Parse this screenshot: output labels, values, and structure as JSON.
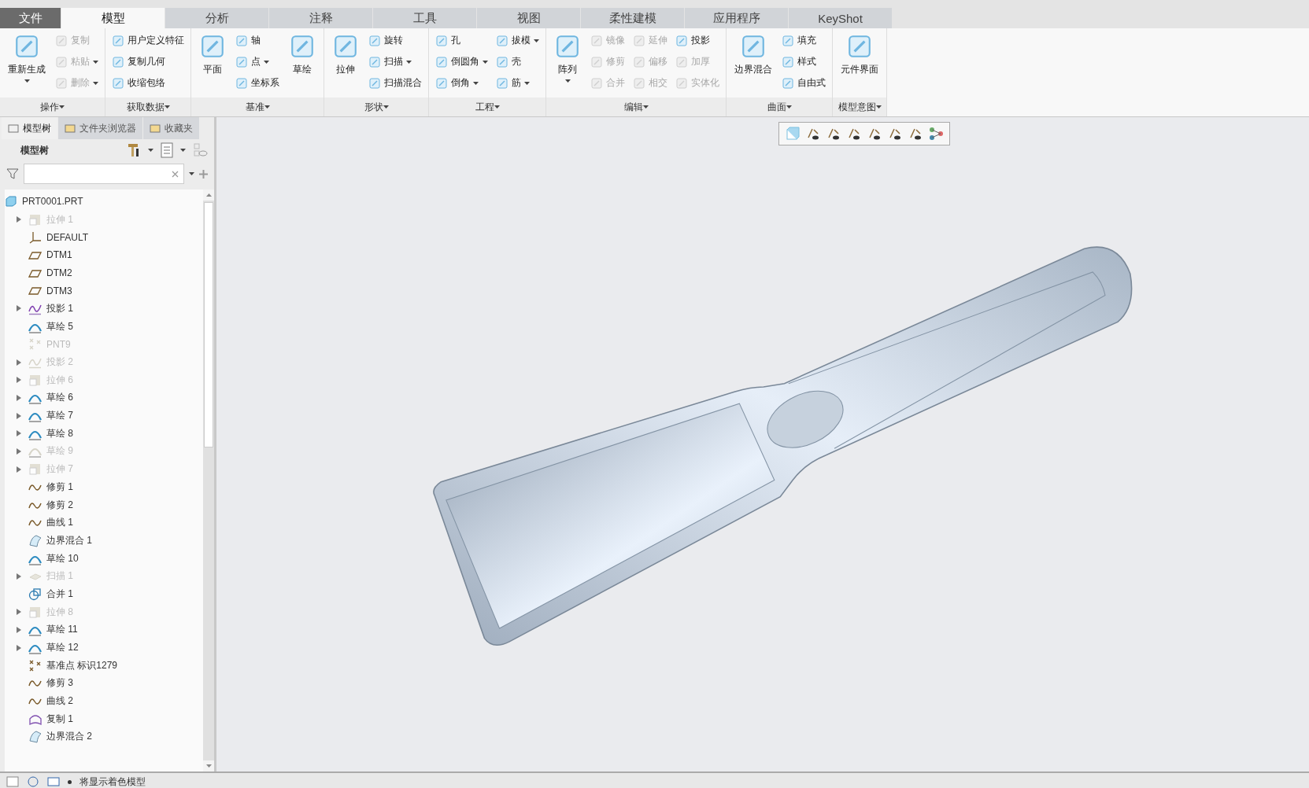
{
  "ribbon_tabs": [
    {
      "label": "文件",
      "kind": "file",
      "selected": false
    },
    {
      "label": "模型",
      "kind": "tab",
      "selected": true
    },
    {
      "label": "分析",
      "kind": "tab",
      "selected": false
    },
    {
      "label": "注释",
      "kind": "tab",
      "selected": false
    },
    {
      "label": "工具",
      "kind": "tab",
      "selected": false
    },
    {
      "label": "视图",
      "kind": "tab",
      "selected": false
    },
    {
      "label": "柔性建模",
      "kind": "tab",
      "selected": false
    },
    {
      "label": "应用程序",
      "kind": "tab",
      "selected": false
    },
    {
      "label": "KeyShot",
      "kind": "tab",
      "selected": false
    }
  ],
  "ribbon_groups": [
    {
      "label": "操作",
      "columns": [
        {
          "kind": "large",
          "items": [
            {
              "label": "重新生成",
              "disabled": false,
              "dropdown": true
            }
          ]
        },
        {
          "kind": "stack",
          "items": [
            {
              "label": "复制",
              "disabled": true,
              "dropdown": false
            },
            {
              "label": "粘贴",
              "disabled": true,
              "dropdown": true
            },
            {
              "label": "删除",
              "disabled": true,
              "dropdown": true
            }
          ]
        }
      ]
    },
    {
      "label": "获取数据",
      "columns": [
        {
          "kind": "stack",
          "items": [
            {
              "label": "用户定义特征",
              "disabled": false,
              "dropdown": false
            },
            {
              "label": "复制几何",
              "disabled": false,
              "dropdown": false
            },
            {
              "label": "收缩包络",
              "disabled": false,
              "dropdown": false
            }
          ]
        }
      ]
    },
    {
      "label": "基准",
      "columns": [
        {
          "kind": "large",
          "items": [
            {
              "label": "平面",
              "disabled": false,
              "dropdown": false
            }
          ]
        },
        {
          "kind": "stack",
          "items": [
            {
              "label": "轴",
              "disabled": false,
              "dropdown": false
            },
            {
              "label": "点",
              "disabled": false,
              "dropdown": true
            },
            {
              "label": "坐标系",
              "disabled": false,
              "dropdown": false
            }
          ]
        },
        {
          "kind": "large",
          "items": [
            {
              "label": "草绘",
              "disabled": false,
              "dropdown": false
            }
          ]
        }
      ]
    },
    {
      "label": "形状",
      "columns": [
        {
          "kind": "large",
          "items": [
            {
              "label": "拉伸",
              "disabled": false,
              "dropdown": false
            }
          ]
        },
        {
          "kind": "stack",
          "items": [
            {
              "label": "旋转",
              "disabled": false,
              "dropdown": false
            },
            {
              "label": "扫描",
              "disabled": false,
              "dropdown": true
            },
            {
              "label": "扫描混合",
              "disabled": false,
              "dropdown": false
            }
          ]
        }
      ]
    },
    {
      "label": "工程",
      "columns": [
        {
          "kind": "stack",
          "items": [
            {
              "label": "孔",
              "disabled": false,
              "dropdown": false
            },
            {
              "label": "倒圆角",
              "disabled": false,
              "dropdown": true
            },
            {
              "label": "倒角",
              "disabled": false,
              "dropdown": true
            }
          ]
        },
        {
          "kind": "stack",
          "items": [
            {
              "label": "拔模",
              "disabled": false,
              "dropdown": true
            },
            {
              "label": "壳",
              "disabled": false,
              "dropdown": false
            },
            {
              "label": "筋",
              "disabled": false,
              "dropdown": true
            }
          ]
        }
      ]
    },
    {
      "label": "编辑",
      "columns": [
        {
          "kind": "large",
          "items": [
            {
              "label": "阵列",
              "disabled": false,
              "dropdown": true
            }
          ]
        },
        {
          "kind": "stack",
          "items": [
            {
              "label": "镜像",
              "disabled": true,
              "dropdown": false
            },
            {
              "label": "修剪",
              "disabled": true,
              "dropdown": false
            },
            {
              "label": "合并",
              "disabled": true,
              "dropdown": false
            }
          ]
        },
        {
          "kind": "stack",
          "items": [
            {
              "label": "延伸",
              "disabled": true,
              "dropdown": false
            },
            {
              "label": "偏移",
              "disabled": true,
              "dropdown": false
            },
            {
              "label": "相交",
              "disabled": true,
              "dropdown": false
            }
          ]
        },
        {
          "kind": "stack",
          "items": [
            {
              "label": "投影",
              "disabled": false,
              "dropdown": false
            },
            {
              "label": "加厚",
              "disabled": true,
              "dropdown": false
            },
            {
              "label": "实体化",
              "disabled": true,
              "dropdown": false
            }
          ]
        }
      ]
    },
    {
      "label": "曲面",
      "columns": [
        {
          "kind": "large",
          "items": [
            {
              "label": "边界混合",
              "disabled": false,
              "dropdown": false
            }
          ]
        },
        {
          "kind": "stack",
          "items": [
            {
              "label": "填充",
              "disabled": false,
              "dropdown": false
            },
            {
              "label": "样式",
              "disabled": false,
              "dropdown": false
            },
            {
              "label": "自由式",
              "disabled": false,
              "dropdown": false
            }
          ]
        }
      ]
    },
    {
      "label": "模型意图",
      "columns": [
        {
          "kind": "large",
          "items": [
            {
              "label": "元件界面",
              "disabled": false,
              "dropdown": false
            }
          ]
        }
      ]
    }
  ],
  "panel_tabs": [
    {
      "label": "模型树",
      "selected": true
    },
    {
      "label": "文件夹浏览器",
      "selected": false
    },
    {
      "label": "收藏夹",
      "selected": false
    }
  ],
  "panel_title": "模型树",
  "tree": {
    "label": "PRT0001.PRT",
    "children": [
      {
        "label": "拉伸 1",
        "kind": "extrude",
        "dimmed": true,
        "expanded": false
      },
      {
        "label": "DEFAULT",
        "kind": "csys",
        "dimmed": false
      },
      {
        "label": "DTM1",
        "kind": "plane",
        "dimmed": false
      },
      {
        "label": "DTM2",
        "kind": "plane",
        "dimmed": false
      },
      {
        "label": "DTM3",
        "kind": "plane",
        "dimmed": false
      },
      {
        "label": "投影 1",
        "kind": "projection",
        "dimmed": false,
        "expanded": false
      },
      {
        "label": "草绘 5",
        "kind": "sketch",
        "dimmed": false
      },
      {
        "label": "PNT9",
        "kind": "point",
        "dimmed": true
      },
      {
        "label": "投影 2",
        "kind": "projection",
        "dimmed": true,
        "expanded": false
      },
      {
        "label": "拉伸 6",
        "kind": "extrude",
        "dimmed": true,
        "expanded": false
      },
      {
        "label": "草绘 6",
        "kind": "sketch",
        "dimmed": false,
        "expanded": false
      },
      {
        "label": "草绘 7",
        "kind": "sketch",
        "dimmed": false,
        "expanded": false
      },
      {
        "label": "草绘 8",
        "kind": "sketch",
        "dimmed": false,
        "expanded": false
      },
      {
        "label": "草绘 9",
        "kind": "sketch",
        "dimmed": true,
        "expanded": false
      },
      {
        "label": "拉伸 7",
        "kind": "extrude",
        "dimmed": true,
        "expanded": false
      },
      {
        "label": "修剪 1",
        "kind": "curve",
        "dimmed": false
      },
      {
        "label": "修剪 2",
        "kind": "curve",
        "dimmed": false
      },
      {
        "label": "曲线 1",
        "kind": "curve",
        "dimmed": false
      },
      {
        "label": "边界混合 1",
        "kind": "boundary",
        "dimmed": false
      },
      {
        "label": "草绘 10",
        "kind": "sketch",
        "dimmed": false
      },
      {
        "label": "扫描 1",
        "kind": "sweep",
        "dimmed": true,
        "expanded": false
      },
      {
        "label": "合并 1",
        "kind": "merge",
        "dimmed": false
      },
      {
        "label": "拉伸 8",
        "kind": "extrude",
        "dimmed": true,
        "expanded": false
      },
      {
        "label": "草绘 11",
        "kind": "sketch",
        "dimmed": false,
        "expanded": false
      },
      {
        "label": "草绘 12",
        "kind": "sketch",
        "dimmed": false,
        "expanded": false
      },
      {
        "label": "基准点 标识1279",
        "kind": "point",
        "dimmed": false
      },
      {
        "label": "修剪 3",
        "kind": "curve",
        "dimmed": false
      },
      {
        "label": "曲线 2",
        "kind": "curve",
        "dimmed": false
      },
      {
        "label": "复制 1",
        "kind": "copy",
        "dimmed": false
      },
      {
        "label": "边界混合 2",
        "kind": "boundary",
        "dimmed": false
      }
    ]
  },
  "status_bar": {
    "message": "将显示着色模型"
  }
}
